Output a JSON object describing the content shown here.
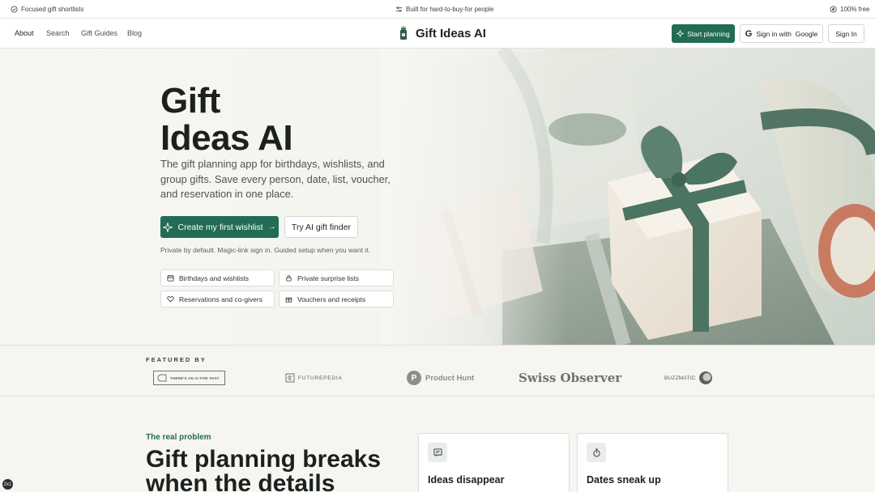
{
  "topbar": {
    "left": "Focused gift shortlists",
    "center": "Built for hard-to-buy-for people",
    "right": "100% free"
  },
  "nav": {
    "links": [
      "About",
      "Search",
      "Gift Guides",
      "Blog"
    ],
    "brand": "Gift Ideas AI",
    "start_planning": "Start planning",
    "google_signin": "Sign in with",
    "google_label": "Google",
    "sign_in": "Sign In"
  },
  "hero": {
    "title_line1": "Gift",
    "title_line2": "Ideas AI",
    "subtitle": "The gift planning app for birthdays, wishlists, and group gifts. Save every person, date, list, voucher, and reservation in one place.",
    "cta_primary": "Create my first wishlist",
    "cta_secondary": "Try AI gift finder",
    "note": "Private by default. Magic-link sign in. Guided setup when you want it.",
    "features": [
      "Birthdays and wishlists",
      "Private surprise lists",
      "Reservations and co-givers",
      "Vouchers and receipts"
    ]
  },
  "featured": {
    "label": "FEATURED BY",
    "logos": [
      "THERE'S AN AI FOR THAT",
      "FUTUREPEDIA",
      "Product Hunt",
      "Swiss Observer",
      "BUZZMATIC"
    ]
  },
  "problem": {
    "eyebrow": "The real problem",
    "title": "Gift planning breaks when the details",
    "cards": [
      "Ideas disappear",
      "Dates sneak up"
    ]
  },
  "badge": "2x1",
  "colors": {
    "accent": "#226c55",
    "background": "#f6f5f1",
    "text": "#1b211d"
  }
}
